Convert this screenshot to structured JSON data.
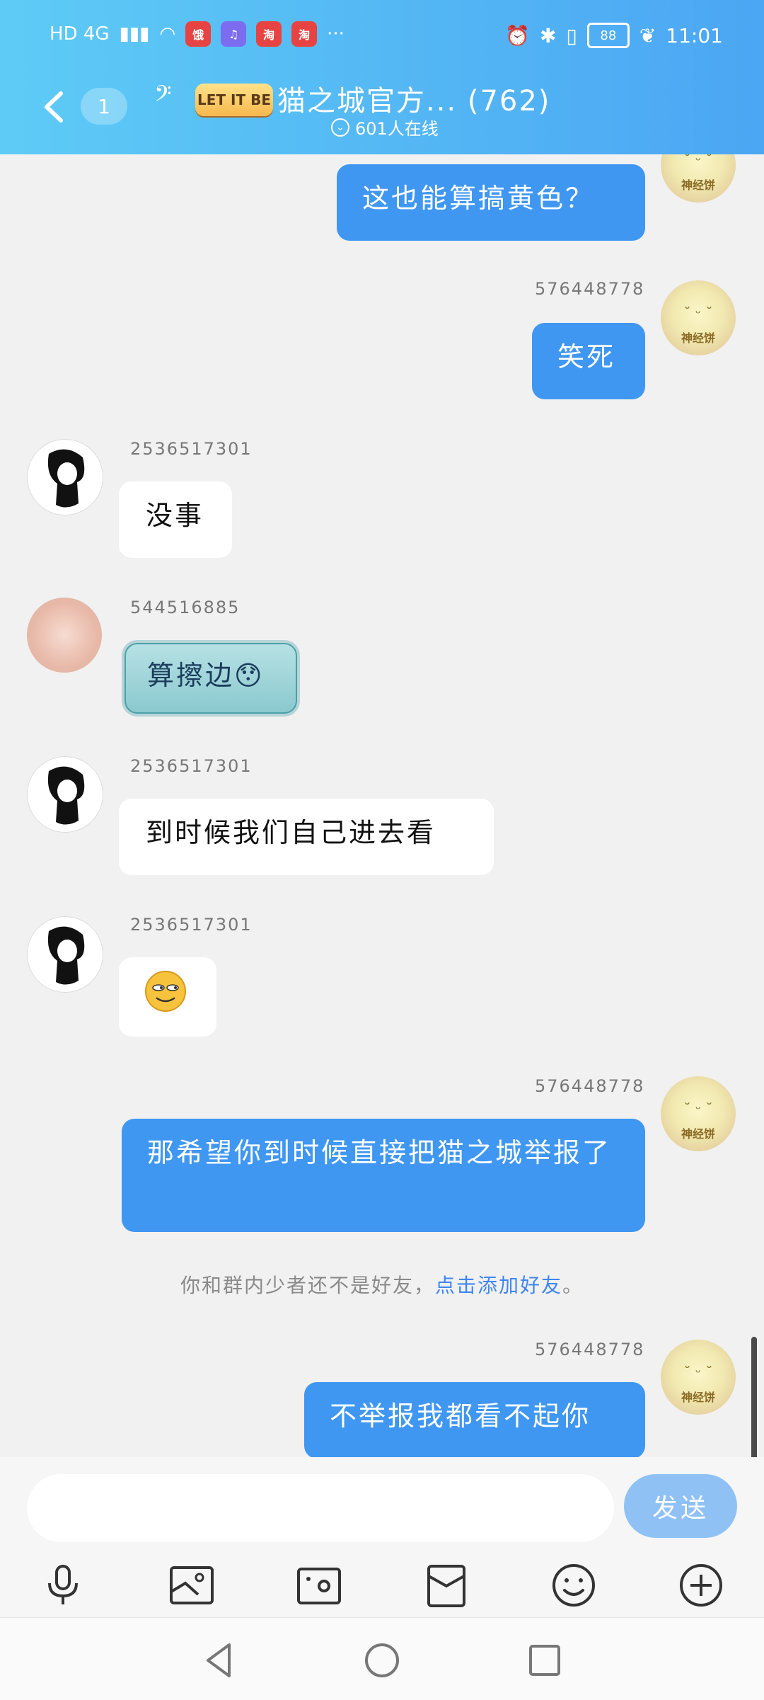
{
  "status_bar": {
    "network": "HD 4G",
    "app_badges": [
      "饿",
      "♫",
      "淘",
      "淘"
    ],
    "more": "···",
    "battery": "88",
    "time": "11:01"
  },
  "header": {
    "unread_count": "1",
    "logo_text": "LET IT BE",
    "title": "猫之城官方... (762)",
    "online": "601人在线"
  },
  "messages": [
    {
      "sender": "",
      "text": "这也能算搞黄色？"
    },
    {
      "sender": "576448778",
      "text": "笑死"
    },
    {
      "sender": "2536517301",
      "text": "没事"
    },
    {
      "sender": "544516885",
      "text": "算擦边"
    },
    {
      "sender": "2536517301",
      "text": "到时候我们自己进去看"
    },
    {
      "sender": "2536517301",
      "text": ""
    },
    {
      "sender": "576448778",
      "text": "那希望你到时候直接把猫之城举报了"
    },
    {
      "sender": "576448778",
      "text": "不举报我都看不起你"
    }
  ],
  "avatar_labels": {
    "bun": "神经饼"
  },
  "system_notice": {
    "text": "你和群内少者还不是好友，",
    "link": "点击添加好友",
    "end": "。"
  },
  "input": {
    "placeholder": "",
    "send_label": "发送"
  },
  "colors": {
    "header_start": "#5ecbf6",
    "header_end": "#4ba6f3",
    "bubble_out": "#3f97f2",
    "send_disabled": "#8fc1f5",
    "link": "#3f86ef"
  }
}
